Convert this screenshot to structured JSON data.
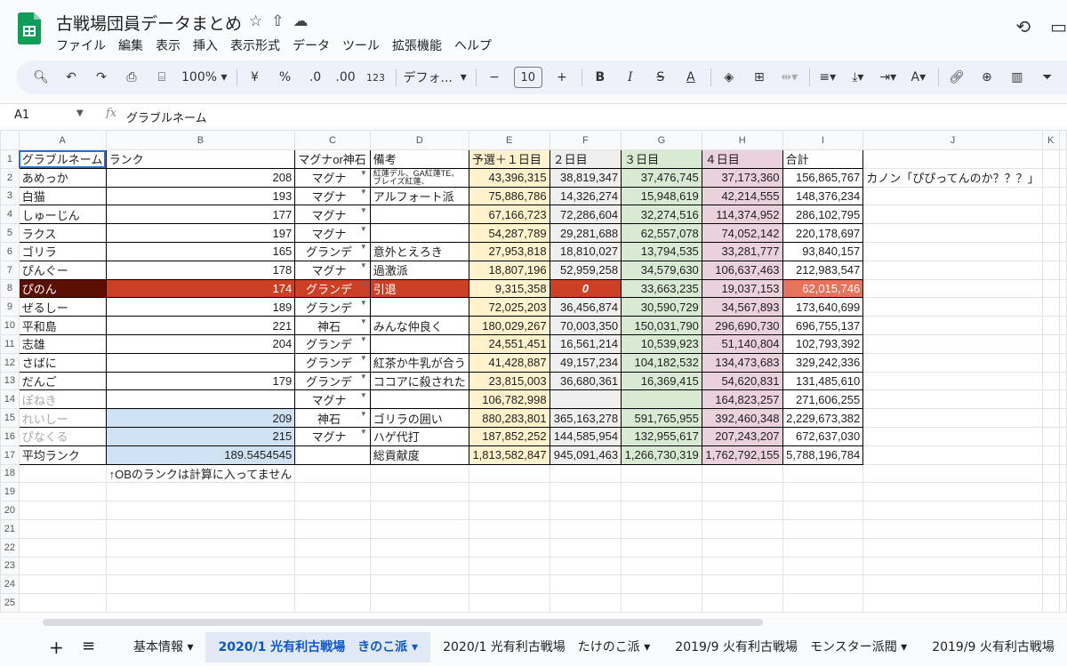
{
  "app": {
    "title": "古戦場団員データまとめ",
    "menu": [
      "ファイル",
      "編集",
      "表示",
      "挿入",
      "表示形式",
      "データ",
      "ツール",
      "拡張機能",
      "ヘルプ"
    ]
  },
  "toolbar": {
    "zoom": "100%",
    "currency": "¥",
    "percent": "%",
    "dec_dec": ".0",
    "dec_inc": ".00",
    "num_format": "123",
    "font": "デフォ...",
    "font_size": "10"
  },
  "formula_bar": {
    "cell_ref": "A1",
    "value": "グラブルネーム"
  },
  "columns": [
    "A",
    "B",
    "C",
    "D",
    "E",
    "F",
    "G",
    "H",
    "I",
    "J",
    "K"
  ],
  "rows": [
    [
      "グラブルネーム",
      "ランク",
      "マグナor神石",
      "備考",
      "予選＋１日目",
      "２日目",
      "３日目",
      "４日目",
      "合計",
      "",
      ""
    ],
    [
      "あめっか",
      "208",
      "マグナ",
      "紅蓮デル、GA紅蓮TE、ブレイズ紅蓮、",
      "43,396,315",
      "38,819,347",
      "37,476,745",
      "37,173,360",
      "156,865,767",
      "カノン「ぴぴってんのか？？？」",
      ""
    ],
    [
      "白猫",
      "193",
      "マグナ",
      "アルフォート派",
      "75,886,786",
      "14,326,274",
      "15,948,619",
      "42,214,555",
      "148,376,234",
      "",
      ""
    ],
    [
      "しゅーじん",
      "177",
      "マグナ",
      "",
      "67,166,723",
      "72,286,604",
      "32,274,516",
      "114,374,952",
      "286,102,795",
      "",
      ""
    ],
    [
      "ラクス",
      "197",
      "マグナ",
      "",
      "54,287,789",
      "29,281,688",
      "62,557,078",
      "74,052,142",
      "220,178,697",
      "",
      ""
    ],
    [
      "ゴリラ",
      "165",
      "グランデ",
      "意外とえろき",
      "27,953,818",
      "18,810,027",
      "13,794,535",
      "33,281,777",
      "93,840,157",
      "",
      ""
    ],
    [
      "ぴんぐー",
      "178",
      "マグナ",
      "過激派",
      "18,807,196",
      "52,959,258",
      "34,579,630",
      "106,637,463",
      "212,983,547",
      "",
      ""
    ],
    [
      "ぴのん",
      "174",
      "グランデ",
      "引退",
      "9,315,358",
      "0",
      "33,663,235",
      "19,037,153",
      "62,015,746",
      "",
      ""
    ],
    [
      "ぜるしー",
      "189",
      "グランデ",
      "",
      "72,025,203",
      "36,456,874",
      "30,590,729",
      "34,567,893",
      "173,640,699",
      "",
      ""
    ],
    [
      "平和島",
      "221",
      "神石",
      "みんな仲良く",
      "180,029,267",
      "70,003,350",
      "150,031,790",
      "296,690,730",
      "696,755,137",
      "",
      ""
    ],
    [
      "志雄",
      "204",
      "グランデ",
      "",
      "24,551,451",
      "16,561,214",
      "10,539,923",
      "51,140,804",
      "102,793,392",
      "",
      ""
    ],
    [
      "さばに",
      "",
      "グランデ",
      "紅茶か牛乳が合う",
      "41,428,887",
      "49,157,234",
      "104,182,532",
      "134,473,683",
      "329,242,336",
      "",
      ""
    ],
    [
      "だんご",
      "179",
      "グランデ",
      "ココアに殺された",
      "23,815,003",
      "36,680,361",
      "16,369,415",
      "54,620,831",
      "131,485,610",
      "",
      ""
    ],
    [
      "ぽねき",
      "",
      "マグナ",
      "",
      "106,782,998",
      "",
      "",
      "164,823,257",
      "271,606,255",
      "",
      ""
    ],
    [
      "れいしー",
      "209",
      "神石",
      "ゴリラの囲い",
      "880,283,801",
      "365,163,278",
      "591,765,955",
      "392,460,348",
      "2,229,673,382",
      "",
      ""
    ],
    [
      "ぴなくる",
      "215",
      "マグナ",
      "ハゲ代打",
      "187,852,252",
      "144,585,954",
      "132,955,617",
      "207,243,207",
      "672,637,030",
      "",
      ""
    ],
    [
      "平均ランク",
      "189.5454545",
      "",
      "総貢献度",
      "1,813,582,847",
      "945,091,463",
      "1,266,730,319",
      "1,762,792,155",
      "5,788,196,784",
      "",
      ""
    ],
    [
      "",
      "↑OBのランクは計算に入ってません",
      "",
      "",
      "",
      "",
      "",
      "",
      "",
      "",
      ""
    ]
  ],
  "empty_rows": [
    19,
    20,
    21,
    22,
    23,
    24,
    25
  ],
  "colors": {
    "yellow": "#fff2cc",
    "gray": "#efefef",
    "green": "#d9ead3",
    "pink": "#ead1dc",
    "blue": "#cfe2f3",
    "dark_red": "#5b0f00",
    "red": "#cc4125",
    "salmon": "#e6735c",
    "accent": "#0b57d0"
  },
  "sheet_tabs": [
    "基本情報",
    "2020/1 光有利古戦場　きのこ派",
    "2020/1 光有利古戦場　たけのこ派",
    "2019/9 火有利古戦場　モンスター派閥",
    "2019/9 火有利古戦場"
  ],
  "active_tab_index": 1
}
